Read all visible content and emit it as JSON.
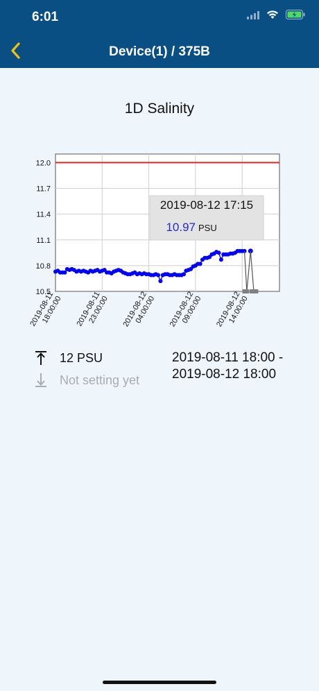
{
  "status_bar": {
    "time": "6:01"
  },
  "nav": {
    "title": "Device(1) / 375B"
  },
  "chart_title": "1D  Salinity",
  "legend": {
    "upper_label": "12 PSU",
    "lower_label": "Not setting yet",
    "range_line1": "2019-08-11 18:00 -",
    "range_line2": "2019-08-12 18:00"
  },
  "tooltip": {
    "timestamp": "2019-08-12 17:15",
    "value": "10.97",
    "unit": "PSU"
  },
  "colors": {
    "header_bg": "#0a4f84",
    "background": "#eef6fc",
    "series": "#0000ff",
    "threshold": "#e8241b"
  },
  "chart_data": {
    "type": "line",
    "title": "1D  Salinity",
    "ylim": [
      10.5,
      12.1
    ],
    "yticks": [
      "12.0",
      "11.7",
      "11.4",
      "11.1",
      "10.8",
      "10.5"
    ],
    "xticks": [
      [
        "2019-08-11",
        "18:00:00"
      ],
      [
        "2019-08-11",
        "23:00:00"
      ],
      [
        "2019-08-12",
        "04:00:00"
      ],
      [
        "2019-08-12",
        "09:00:00"
      ],
      [
        "2019-08-12",
        "14:00:00"
      ]
    ],
    "x_hours": [
      0,
      24
    ],
    "threshold_upper": 12.0,
    "series": [
      {
        "points": [
          [
            0,
            10.73
          ],
          [
            0.25,
            10.74
          ],
          [
            0.5,
            10.72
          ],
          [
            0.75,
            10.72
          ],
          [
            1,
            10.72
          ],
          [
            1.25,
            10.76
          ],
          [
            1.5,
            10.75
          ],
          [
            1.75,
            10.76
          ],
          [
            2,
            10.75
          ],
          [
            2.25,
            10.73
          ],
          [
            2.5,
            10.74
          ],
          [
            2.75,
            10.73
          ],
          [
            3,
            10.74
          ],
          [
            3.25,
            10.73
          ],
          [
            3.5,
            10.72
          ],
          [
            3.75,
            10.74
          ],
          [
            4,
            10.73
          ],
          [
            4.25,
            10.74
          ],
          [
            4.5,
            10.75
          ],
          [
            4.75,
            10.73
          ],
          [
            5,
            10.74
          ],
          [
            5.25,
            10.75
          ],
          [
            5.5,
            10.72
          ],
          [
            5.75,
            10.72
          ],
          [
            6,
            10.71
          ],
          [
            6.25,
            10.73
          ],
          [
            6.5,
            10.74
          ],
          [
            6.75,
            10.75
          ],
          [
            7,
            10.74
          ],
          [
            7.25,
            10.72
          ],
          [
            7.5,
            10.71
          ],
          [
            7.75,
            10.7
          ],
          [
            8,
            10.7
          ],
          [
            8.25,
            10.71
          ],
          [
            8.5,
            10.72
          ],
          [
            8.75,
            10.7
          ],
          [
            9,
            10.71
          ],
          [
            9.25,
            10.7
          ],
          [
            9.5,
            10.71
          ],
          [
            9.75,
            10.7
          ],
          [
            10,
            10.7
          ],
          [
            10.25,
            10.69
          ],
          [
            10.5,
            10.69
          ],
          [
            10.75,
            10.7
          ],
          [
            11,
            10.69
          ],
          [
            11.25,
            10.62
          ],
          [
            11.5,
            10.69
          ],
          [
            11.75,
            10.7
          ],
          [
            12,
            10.7
          ],
          [
            12.25,
            10.69
          ],
          [
            12.5,
            10.69
          ],
          [
            12.75,
            10.7
          ],
          [
            13,
            10.69
          ],
          [
            13.25,
            10.69
          ],
          [
            13.5,
            10.69
          ],
          [
            13.75,
            10.7
          ],
          [
            14,
            10.74
          ],
          [
            14.25,
            10.75
          ],
          [
            14.5,
            10.76
          ],
          [
            14.75,
            10.79
          ],
          [
            15,
            10.8
          ],
          [
            15.25,
            10.82
          ],
          [
            15.5,
            10.82
          ],
          [
            15.75,
            10.87
          ],
          [
            16,
            10.89
          ],
          [
            16.25,
            10.89
          ],
          [
            16.5,
            10.9
          ],
          [
            16.75,
            10.93
          ],
          [
            17,
            10.94
          ],
          [
            17.25,
            10.96
          ],
          [
            17.5,
            10.95
          ],
          [
            17.75,
            10.87
          ],
          [
            18,
            10.93
          ],
          [
            18.25,
            10.93
          ],
          [
            18.5,
            10.93
          ],
          [
            18.75,
            10.94
          ],
          [
            19,
            10.94
          ],
          [
            19.25,
            10.95
          ],
          [
            19.5,
            10.97
          ],
          [
            19.75,
            10.97
          ],
          [
            20,
            10.97
          ],
          [
            20.25,
            10.97
          ]
        ]
      }
    ],
    "gap_markers": [
      {
        "x": 20.25,
        "y": 10.5
      },
      {
        "x": 20.5,
        "y": 10.5
      },
      {
        "x": 21.0,
        "y": 10.5
      },
      {
        "x": 21.25,
        "y": 10.5
      },
      {
        "x": 21.5,
        "y": 10.5
      }
    ],
    "drop_line_from": {
      "x": 20.25,
      "y": 10.97
    },
    "drop_line_to": {
      "x": 20.9,
      "y": 10.97
    },
    "highlighted_point": {
      "x": 20.9,
      "y": 10.97
    },
    "grid": true
  }
}
